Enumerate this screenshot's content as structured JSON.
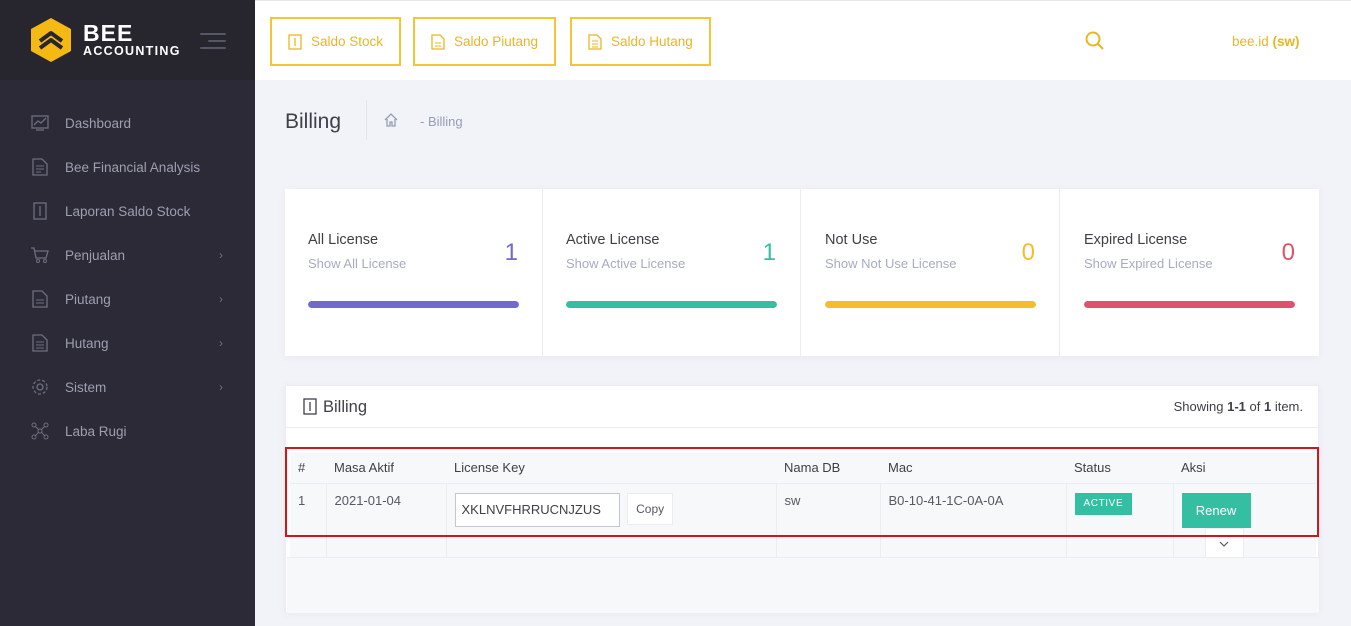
{
  "brand": {
    "line1": "BEE",
    "line2": "ACCOUNTING"
  },
  "sidebar": {
    "items": [
      {
        "label": "Dashboard",
        "icon": "chart-icon",
        "has_children": false
      },
      {
        "label": "Bee Financial Analysis",
        "icon": "report-icon",
        "has_children": false
      },
      {
        "label": "Laporan Saldo Stock",
        "icon": "invoice-icon",
        "has_children": false
      },
      {
        "label": "Penjualan",
        "icon": "cart-icon",
        "has_children": true
      },
      {
        "label": "Piutang",
        "icon": "document-icon",
        "has_children": true
      },
      {
        "label": "Hutang",
        "icon": "file-icon",
        "has_children": true
      },
      {
        "label": "Sistem",
        "icon": "gear-icon",
        "has_children": true
      },
      {
        "label": "Laba Rugi",
        "icon": "network-icon",
        "has_children": false
      }
    ],
    "chevron": "›"
  },
  "topbar": {
    "buttons": [
      {
        "label": "Saldo Stock"
      },
      {
        "label": "Saldo Piutang"
      },
      {
        "label": "Saldo Hutang"
      }
    ],
    "user_name": "bee.id ",
    "user_db": "(sw)"
  },
  "subheader": {
    "title": "Billing",
    "breadcrumb": "- Billing"
  },
  "stats": [
    {
      "title": "All License",
      "subtitle": "Show All License",
      "value": "1",
      "color": "#716aca",
      "fill": 1
    },
    {
      "title": "Active License",
      "subtitle": "Show Active License",
      "value": "1",
      "color": "#34bfa3",
      "fill": 1
    },
    {
      "title": "Not Use",
      "subtitle": "Show Not Use License",
      "value": "0",
      "color": "#f4bd2d",
      "fill": 1
    },
    {
      "title": "Expired License",
      "subtitle": "Show Expired License",
      "value": "0",
      "color": "#e0526c",
      "fill": 1
    }
  ],
  "billing": {
    "title": "Billing",
    "summary_prefix": "Showing ",
    "summary_range": "1-1",
    "summary_mid": " of ",
    "summary_total": "1",
    "summary_suffix": " item.",
    "columns": [
      "#",
      "Masa Aktif",
      "License Key",
      "Nama DB",
      "Mac",
      "Status",
      "Aksi"
    ],
    "rows": [
      {
        "no": "1",
        "masa_aktif": "2021-01-04",
        "license_key": "XKLNVFHRRUCNJZUS",
        "nama_db": "sw",
        "mac": "B0-10-41-1C-0A-0A",
        "status": "ACTIVE"
      }
    ],
    "copy_label": "Copy",
    "renew_label": "Renew"
  },
  "colors": {
    "accent": "#f4c633",
    "success": "#34bfa3",
    "highlight": "#d0151c"
  }
}
